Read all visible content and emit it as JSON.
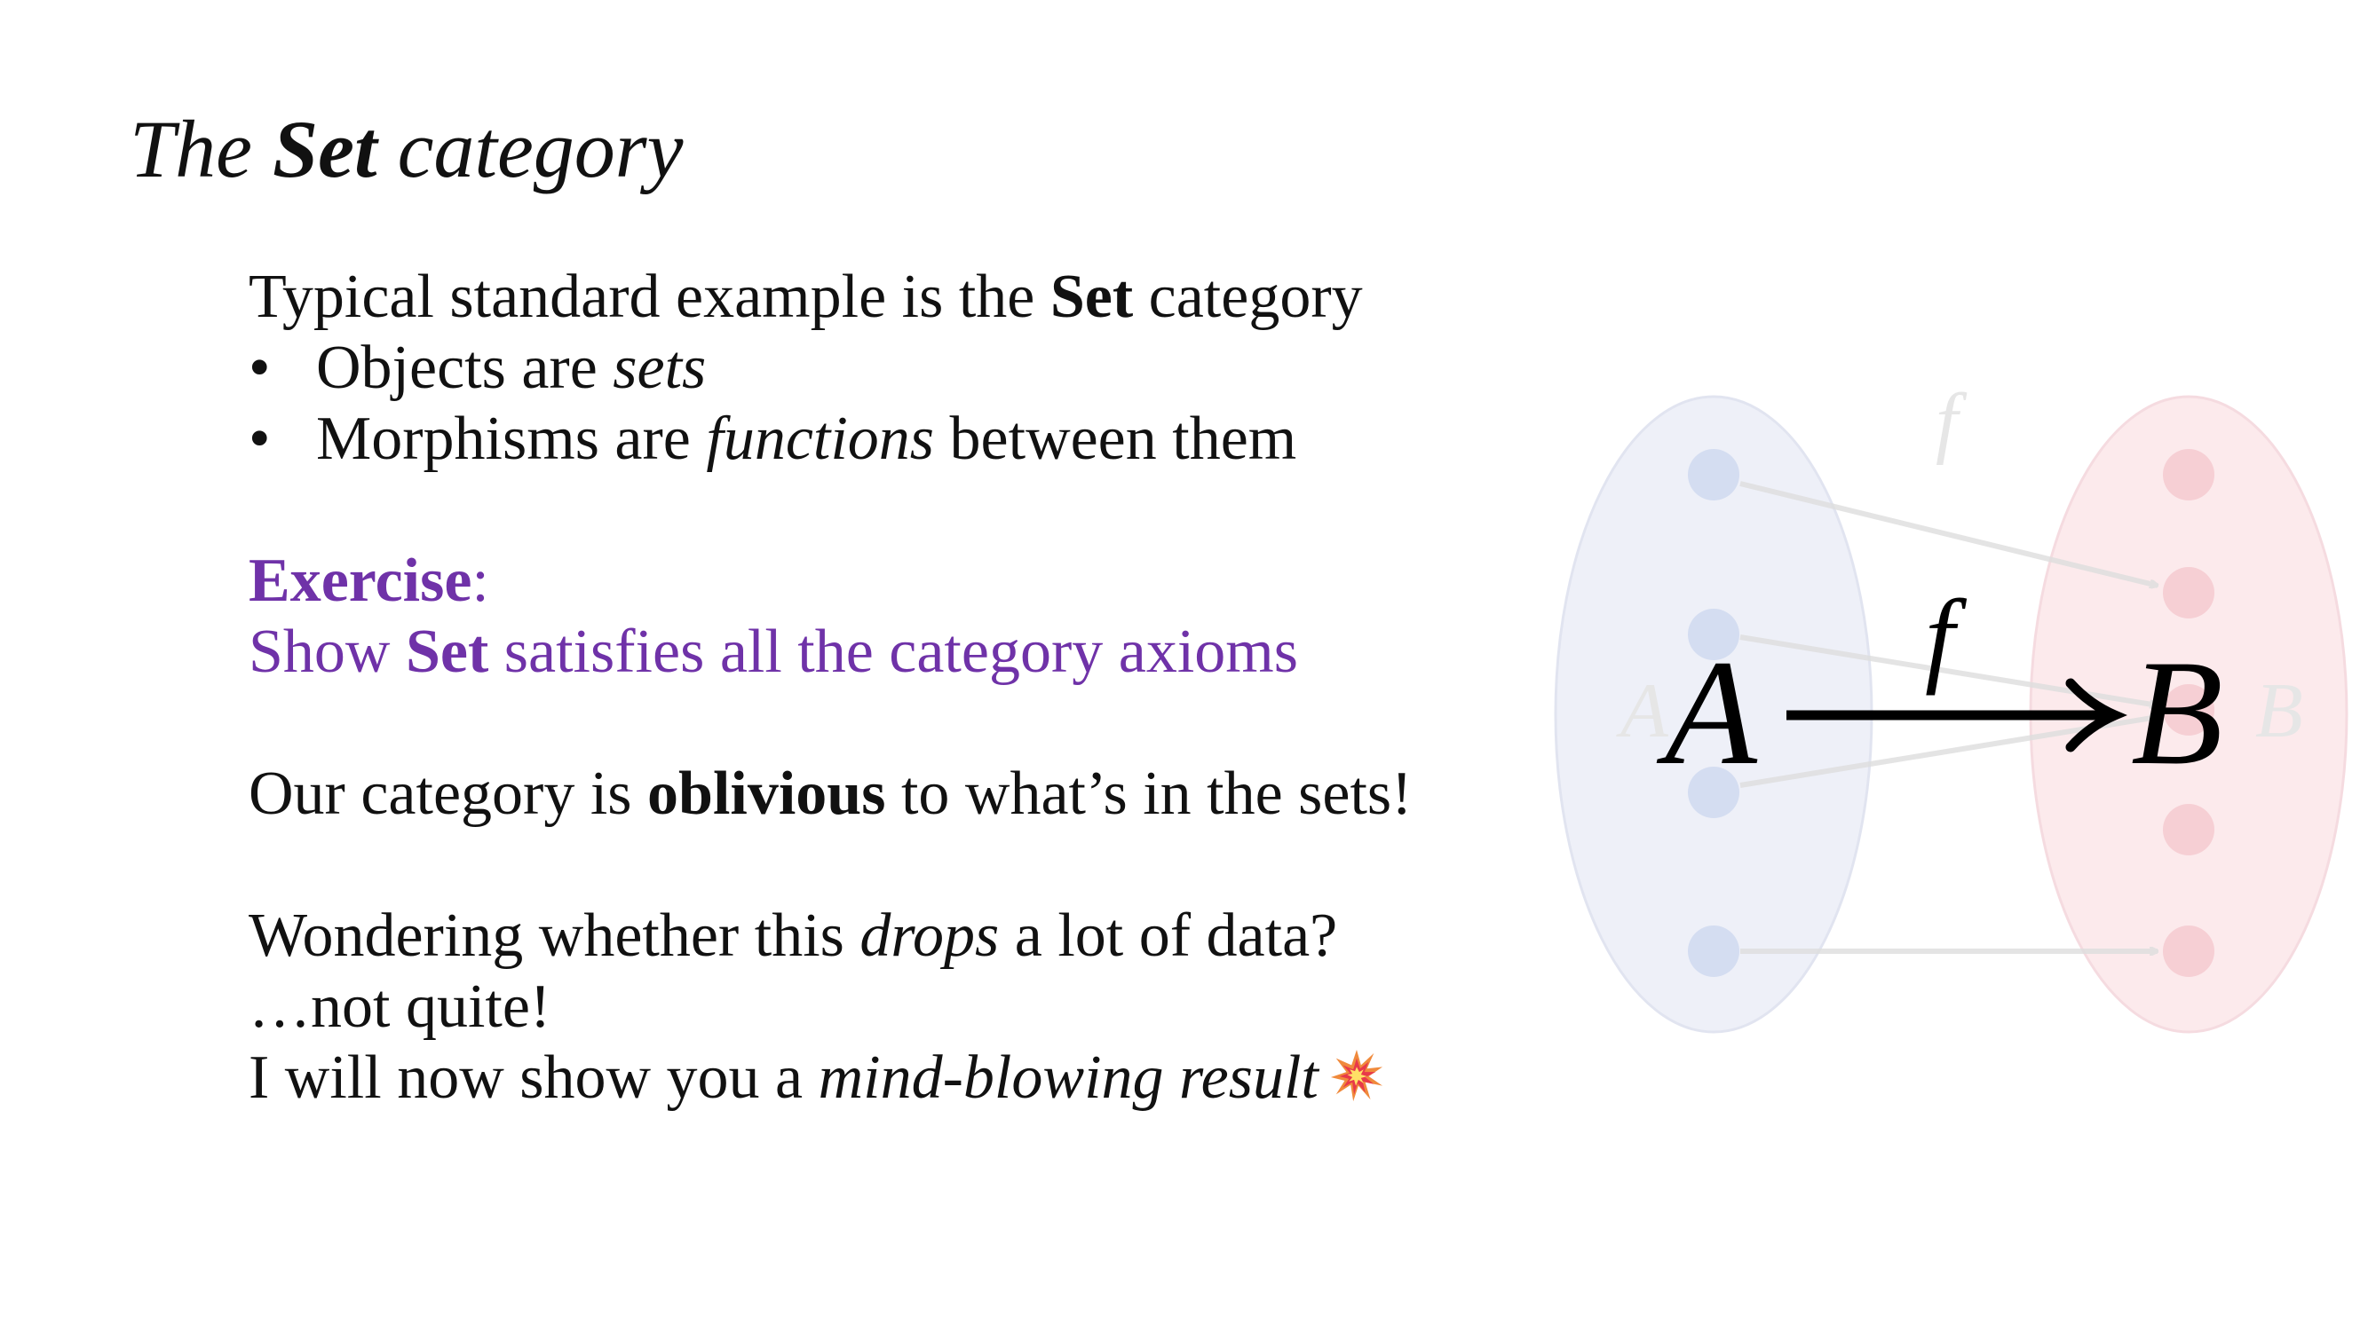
{
  "slide": {
    "title": {
      "prefix": "The ",
      "bold": "Set",
      "suffix": " category"
    },
    "intro": {
      "before": "Typical standard example is the ",
      "bold": "Set",
      "after": " category"
    },
    "bullets": [
      {
        "symbol": "•",
        "text": "Objects are ",
        "italic": "sets",
        "after": ""
      },
      {
        "symbol": "•",
        "text": "Morphisms are ",
        "italic": "functions",
        "after": " between them"
      }
    ],
    "exercise": {
      "label": "Exercise",
      "colon": ":",
      "line_before": "Show ",
      "line_bold": "Set",
      "line_after": " satisfies all the category axioms"
    },
    "oblivious": {
      "before": "Our category is ",
      "bold": "oblivious",
      "after": " to what’s in the sets!"
    },
    "wondering": {
      "before": "Wondering whether this ",
      "italic": "drops",
      "after": " a lot of data?"
    },
    "not_quite": "…not quite!",
    "will_show": {
      "before": "I will now show you a ",
      "italic": "mind-blowing result"
    },
    "emoji_icon": "collision-icon"
  },
  "diagram": {
    "main_source": "A",
    "main_target": "B",
    "main_arrow_label": "f",
    "faded_source": "A",
    "faded_target": "B",
    "faded_label": "f",
    "colors": {
      "set_a_fill": "#e9ecf6",
      "set_a_dot": "#c9d4ee",
      "set_b_fill": "#fbe3e6",
      "set_b_dot": "#f4c3ca",
      "faded_arrow": "#dedede",
      "faded_text": "#e6e6e6",
      "main": "#000000",
      "exercise": "#6f32a8"
    }
  }
}
